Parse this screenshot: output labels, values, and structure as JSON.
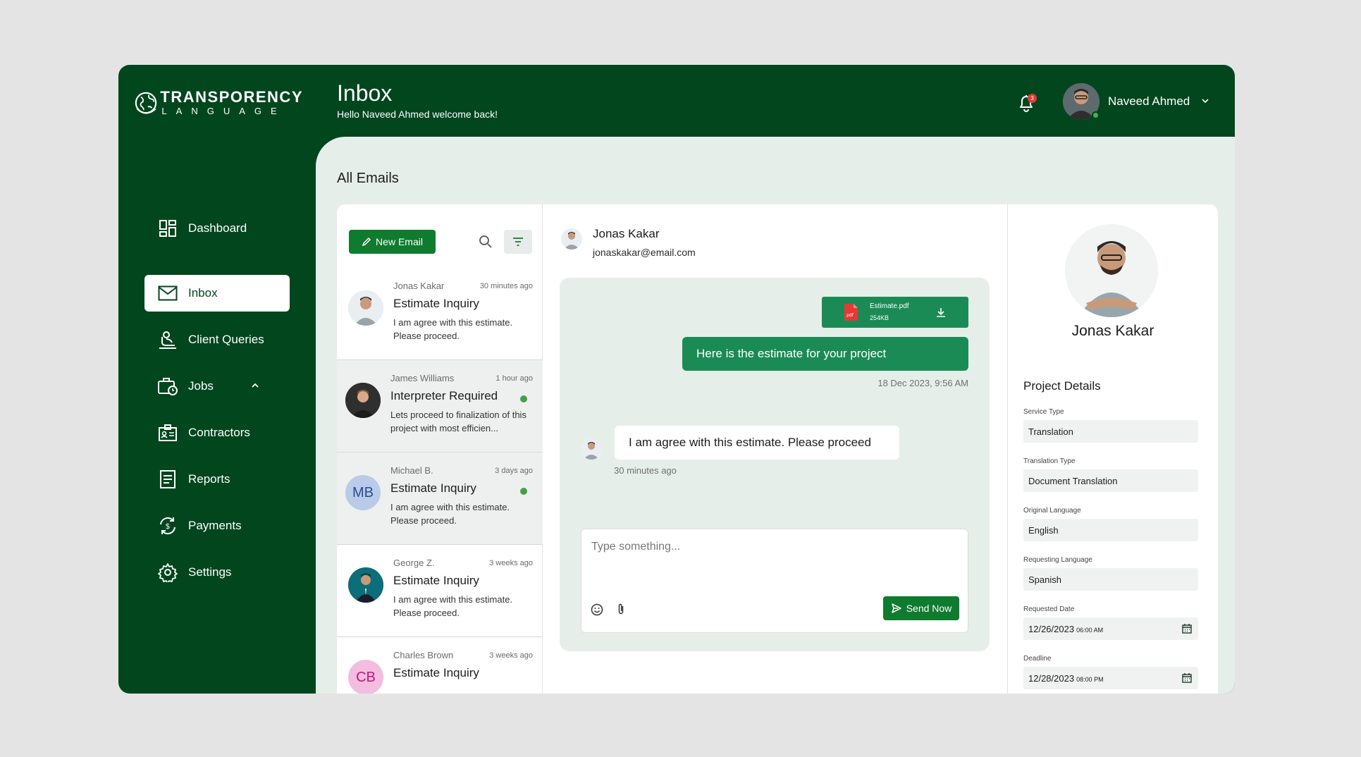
{
  "brand": {
    "line1": "TRANSPORENCY",
    "line2": "LANGUAGE"
  },
  "header": {
    "title": "Inbox",
    "subtitle": "Hello Naveed Ahmed welcome back!",
    "notification_count": "3",
    "user_name": "Naveed Ahmed"
  },
  "sidebar": {
    "items": [
      {
        "label": "Dashboard",
        "icon": "dashboard-icon"
      },
      {
        "label": "Inbox",
        "icon": "mail-icon"
      },
      {
        "label": "Client Queries",
        "icon": "client-queries-icon"
      },
      {
        "label": "Jobs",
        "icon": "briefcase-clock-icon"
      },
      {
        "label": "Contractors",
        "icon": "id-card-icon"
      },
      {
        "label": "Reports",
        "icon": "report-icon"
      },
      {
        "label": "Payments",
        "icon": "payment-cycle-icon"
      },
      {
        "label": "Settings",
        "icon": "gear-icon"
      }
    ]
  },
  "main": {
    "section_title": "All Emails"
  },
  "list": {
    "new_email_label": "New Email",
    "emails": [
      {
        "sender": "Jonas Kakar",
        "time": "30 minutes ago",
        "subject": "Estimate Inquiry",
        "preview": "I am agree with this estimate. Please proceed."
      },
      {
        "sender": "James Williams",
        "time": "1 hour ago",
        "subject": "Interpreter Required",
        "preview": "Lets proceed to finalization of this project with most efficien..."
      },
      {
        "sender": "Michael B.",
        "time": "3 days ago",
        "subject": "Estimate Inquiry",
        "preview": "I am agree with this estimate. Please proceed.",
        "initials": "MB"
      },
      {
        "sender": "George Z.",
        "time": "3 weeks ago",
        "subject": "Estimate Inquiry",
        "preview": "I am agree with this estimate. Please proceed."
      },
      {
        "sender": "Charles Brown",
        "time": "3 weeks ago",
        "subject": "Estimate Inquiry",
        "initials": "CB"
      }
    ]
  },
  "chat": {
    "contact_name": "Jonas Kakar",
    "contact_email": "jonaskakar@email.com",
    "attachment": {
      "name": "Estimate.pdf",
      "size": "254KB",
      "type_label": "pdf"
    },
    "outgoing": {
      "text": "Here is the estimate for your project",
      "time": "18 Dec 2023, 9:56 AM"
    },
    "incoming": {
      "text": "I am agree with this estimate. Please proceed",
      "time": "30 minutes ago"
    },
    "composer": {
      "placeholder": "Type something...",
      "send_label": "Send Now"
    }
  },
  "details": {
    "name": "Jonas Kakar",
    "section_title": "Project Details",
    "fields": [
      {
        "label": "Service Type",
        "value": "Translation"
      },
      {
        "label": "Translation Type",
        "value": "Document Translation"
      },
      {
        "label": "Original Language",
        "value": "English"
      },
      {
        "label": "Requesting Language",
        "value": "Spanish"
      },
      {
        "label": "Requested Date",
        "value": "12/26/2023",
        "time": "06:00 AM"
      },
      {
        "label": "Deadline",
        "value": "12/28/2023",
        "time": "08:00 PM"
      }
    ]
  },
  "colors": {
    "brand_green": "#02461e",
    "button_green": "#0f7b2e",
    "bubble_green": "#1a8b54",
    "content_bg": "#e6eeea",
    "online_dot": "#43a047",
    "badge_red": "#e53935"
  }
}
